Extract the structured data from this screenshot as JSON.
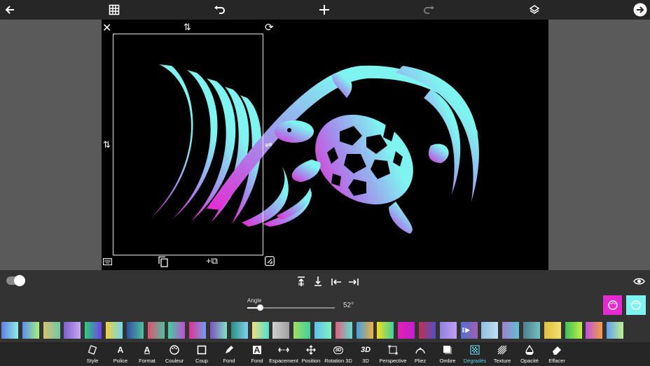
{
  "topbar": {
    "icons": [
      "back-arrow-icon",
      "grid-icon",
      "undo-icon",
      "add-icon",
      "redo-icon",
      "layers-icon",
      "forward-arrow-icon"
    ]
  },
  "colors": {
    "background": "#262626",
    "panel": "#333333",
    "canvas": "#000000",
    "stage": "#5a5a5a",
    "accent_active": "#5fd3e6",
    "swatch_magenta": "#e62ad2",
    "swatch_cyan": "#7ff3f0"
  },
  "artwork": {
    "gradient_start": "#e62ad2",
    "gradient_end": "#7ff3f0"
  },
  "angle": {
    "label": "Angle",
    "value_text": "52°",
    "slider_fraction": 0.14
  },
  "swatches": [
    [
      "#5f7fe0",
      "#8ff0e8"
    ],
    [
      "#5a8ff0",
      "#a8f07a"
    ],
    [
      "#d9c070",
      "#6fc8a8"
    ],
    [
      "#7b5fd0",
      "#c8a8f0"
    ],
    [
      "#2bd07a",
      "#6e40f0"
    ],
    [
      "#f0d040",
      "#70d8f0"
    ],
    [
      "#3050a0",
      "#50c0a0"
    ],
    [
      "#e05070",
      "#50c0a0"
    ],
    [
      "#40d0a0",
      "#c050d0"
    ],
    [
      "#e03090",
      "#70a0f0"
    ],
    [
      "#8050c0",
      "#80e0c0"
    ],
    [
      "#2a9080",
      "#80d0f0"
    ],
    [
      "#f0e080",
      "#50e0d0"
    ],
    [
      "#d0d0d0",
      "#a0a0a0"
    ],
    [
      "#a0e060",
      "#40d0a0"
    ],
    [
      "#60c0f0",
      "#80f0c0"
    ],
    [
      "#e06080",
      "#60e0d0"
    ],
    [
      "#40a0e0",
      "#f0b040"
    ],
    [
      "#f0e020",
      "#40d0a0"
    ],
    [
      "#e020b0",
      "#c020d0"
    ],
    [
      "#c03050",
      "#5050c0"
    ],
    [
      "#9080e0",
      "#c0a0f0"
    ],
    [
      "#5070d0",
      "#a060b0"
    ],
    [
      "#90c0e0",
      "#c0e0f0"
    ],
    [
      "#a080d0",
      "#60c0d0"
    ],
    [
      "#508090",
      "#70c0c0"
    ],
    [
      "#e0c040",
      "#f0e070"
    ],
    [
      "#40c060",
      "#c0f040"
    ],
    [
      "#c050e0",
      "#f0a040"
    ],
    [
      "#60a0f0",
      "#c0f090"
    ]
  ],
  "tools": [
    {
      "label": "Style",
      "icon": "style-icon"
    },
    {
      "label": "Police",
      "icon": "font-icon"
    },
    {
      "label": "Format",
      "icon": "format-icon"
    },
    {
      "label": "Couleur",
      "icon": "palette-icon"
    },
    {
      "label": "Coup",
      "icon": "stroke-icon"
    },
    {
      "label": "Fond",
      "icon": "pen-icon"
    },
    {
      "label": "Fond",
      "icon": "text-background-icon"
    },
    {
      "label": "Espacement",
      "icon": "spacing-icon"
    },
    {
      "label": "Position",
      "icon": "position-icon"
    },
    {
      "label": "Rotation 3D",
      "icon": "rotation-3d-icon"
    },
    {
      "label": "3D",
      "icon": "3d-icon"
    },
    {
      "label": "Perspective",
      "icon": "perspective-icon"
    },
    {
      "label": "Pliez",
      "icon": "bend-icon"
    },
    {
      "label": "Ombre",
      "icon": "shadow-icon"
    },
    {
      "label": "Dégradés",
      "icon": "gradient-icon",
      "active": true
    },
    {
      "label": "Texture",
      "icon": "texture-icon"
    },
    {
      "label": "Opacité",
      "icon": "opacity-icon"
    },
    {
      "label": "Effacer",
      "icon": "eraser-icon"
    }
  ],
  "tool_glyphs": {
    "font_letter": "A",
    "format_letter": "A",
    "text_bg_letter": "A",
    "rotation_3d_text": "3D",
    "three_d_text": "3D"
  }
}
